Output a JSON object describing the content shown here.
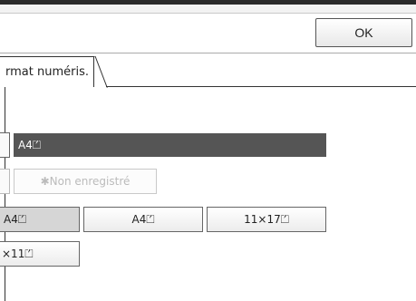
{
  "header": {
    "ok_label": "OK"
  },
  "tabs": [
    {
      "label": "rmat numéris."
    }
  ],
  "size_row": {
    "selected_value": "A4⏍"
  },
  "preset": {
    "label": "✱Non enregistré"
  },
  "paper_buttons": [
    {
      "label": "A4⏍"
    },
    {
      "label": "A4⏍"
    },
    {
      "label": "11×17⏍"
    },
    {
      "label": "×11⏍"
    }
  ]
}
